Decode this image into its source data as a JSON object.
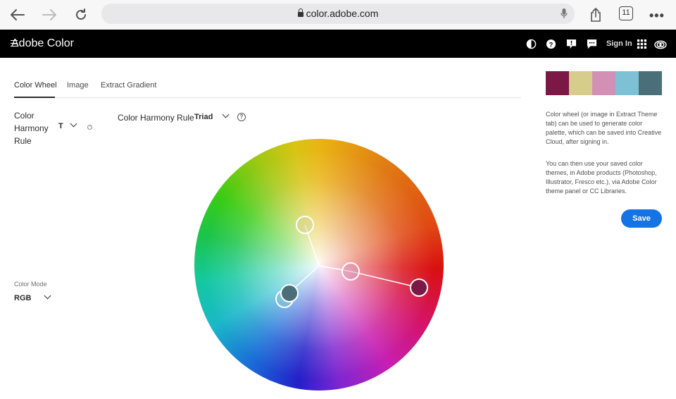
{
  "browser": {
    "url": "color.adobe.com",
    "tab_count": "11"
  },
  "header": {
    "title": "Adobe Color",
    "sign_in": "Sign In"
  },
  "tabs": [
    {
      "label": "Color Wheel",
      "active": true
    },
    {
      "label": "Image",
      "active": false
    },
    {
      "label": "Extract Gradient",
      "active": false
    }
  ],
  "left_panel": {
    "harmony_label": "Color Harmony Rule",
    "harmony_value": "T",
    "mode_label": "Color Mode",
    "mode_value": "RGB"
  },
  "wheel_toolbar": {
    "rule_label": "Color Harmony Rule",
    "rule_value": "Triad",
    "help_glyph": "?"
  },
  "palette": {
    "swatches": [
      "#7b1845",
      "#d6cc8c",
      "#d291b4",
      "#7ec1d6",
      "#4a6f78"
    ]
  },
  "info": {
    "paragraph1": "Color wheel (or image in Extract Theme tab) can be used to generate color palette, which can be saved into Creative Cloud, after signing in.",
    "paragraph2": "You can then use your saved color themes, in Adobe products (Photoshop, Illustrator, Fresco etc.), via Adobe Color theme panel or CC Libraries.",
    "save_label": "Save"
  },
  "colors": {
    "accent": "#1473e6",
    "header_bg": "#000000"
  }
}
